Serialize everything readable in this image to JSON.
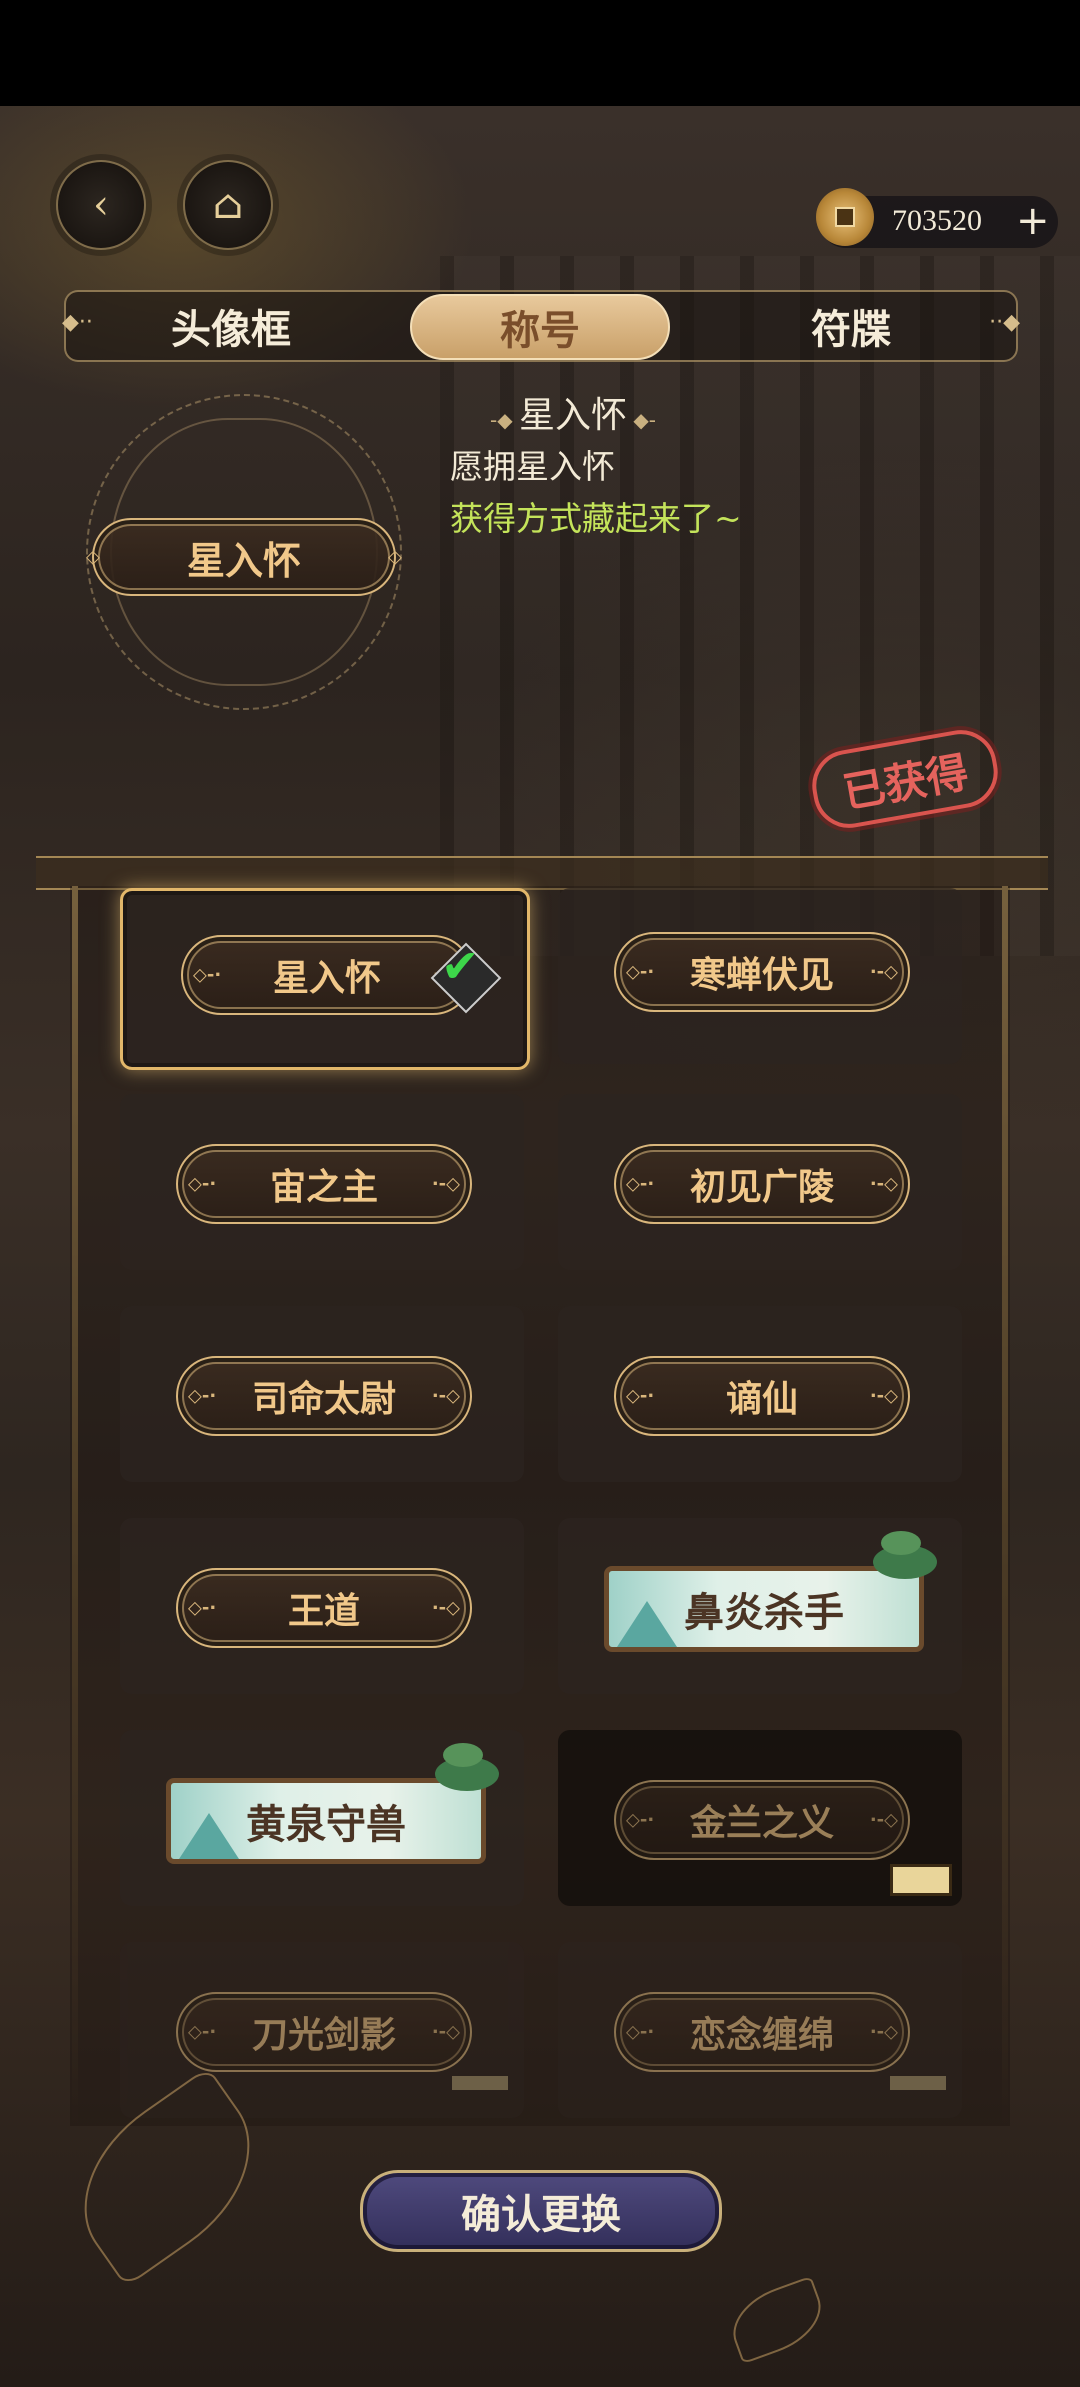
{
  "currency": {
    "amount": "703520",
    "plus": "+"
  },
  "tabs": [
    {
      "label": "头像框"
    },
    {
      "label": "称号"
    },
    {
      "label": "符牒"
    }
  ],
  "preview": {
    "plaque": "星入怀",
    "name": "星入怀",
    "description": "愿拥星入怀",
    "source": "获得方式藏起来了~",
    "stamp": "已获得"
  },
  "titles": [
    {
      "label": "星入怀",
      "selected": true
    },
    {
      "label": "寒蝉伏见"
    },
    {
      "label": "宙之主"
    },
    {
      "label": "初见广陵"
    },
    {
      "label": "司命太尉"
    },
    {
      "label": "谪仙"
    },
    {
      "label": "王道"
    },
    {
      "label": "鼻炎杀手",
      "style": "scenic"
    },
    {
      "label": "黄泉守兽",
      "style": "scenic"
    },
    {
      "label": "金兰之义",
      "locked": true
    },
    {
      "label": "刀光剑影",
      "locked": true
    },
    {
      "label": "恋念缠绵",
      "locked": true
    }
  ],
  "confirm_label": "确认更换",
  "icons": {
    "back": "back-arrow-icon",
    "home": "pavilion-icon",
    "coin": "copper-coin-icon",
    "check": "checkmark-icon"
  },
  "colors": {
    "gold": "#d9b67c",
    "title_text": "#f1c88a",
    "source_text": "#c4e45a",
    "stamp_red": "#d9544e"
  }
}
